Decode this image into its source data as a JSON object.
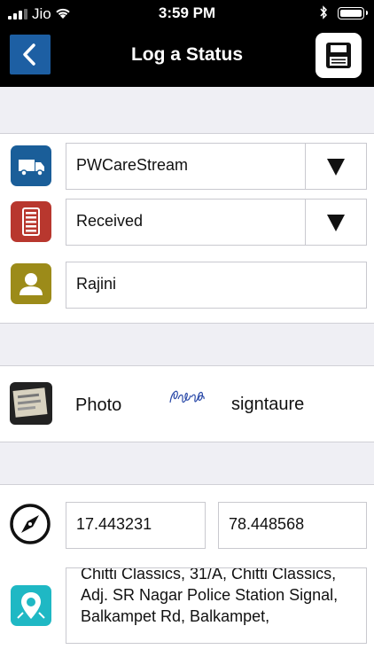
{
  "status_bar": {
    "carrier": "Jio",
    "time": "3:59 PM"
  },
  "header": {
    "title": "Log a Status",
    "back_icon": "chevron-left-icon",
    "save_icon": "floppy-disk-icon"
  },
  "form": {
    "account": {
      "value": "PWCareStream",
      "icon": "truck-icon"
    },
    "status": {
      "value": "Received",
      "icon": "list-icon"
    },
    "name": {
      "value": "Rajini",
      "icon": "person-icon"
    },
    "photo": {
      "label": "Photo",
      "icon": "photo-thumbnail"
    },
    "signature": {
      "label": "signtaure",
      "icon": "signature-image"
    },
    "latitude": {
      "value": "17.443231",
      "icon": "compass-icon"
    },
    "longitude": {
      "value": "78.448568"
    },
    "address": {
      "icon": "location-pin-icon",
      "value": "Chitti Classics, 31/A, Chitti Classics, Adj. SR Nagar Police Station Signal, Balkampet Rd, Balkampet,"
    }
  },
  "colors": {
    "nav_bg": "#000000",
    "back_button": "#1d5fa3",
    "truck_icon_bg": "#1a5e99",
    "list_icon_bg": "#b8372e",
    "person_icon_bg": "#9c8b19",
    "location_icon_bg": "#1fb8c4",
    "section_bg": "#efeff4"
  }
}
